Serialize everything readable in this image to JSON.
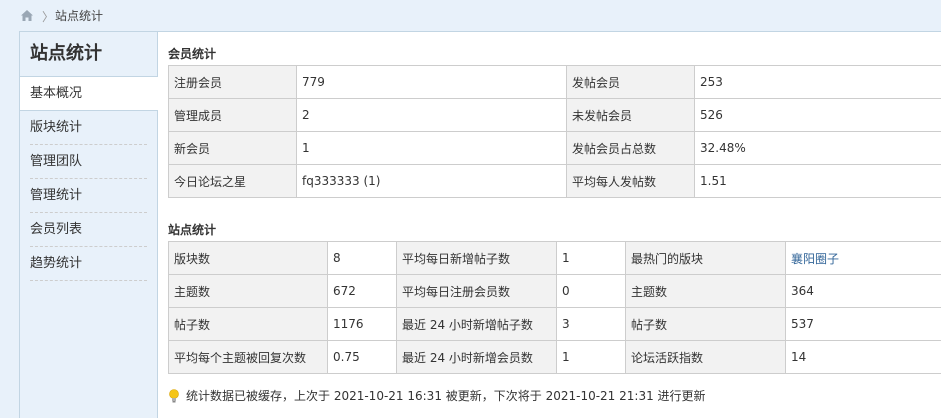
{
  "breadcrumb": {
    "separator": "〉",
    "current": "站点统计"
  },
  "sidebar": {
    "title": "站点统计",
    "items": [
      {
        "label": "基本概况"
      },
      {
        "label": "版块统计"
      },
      {
        "label": "管理团队"
      },
      {
        "label": "管理统计"
      },
      {
        "label": "会员列表"
      },
      {
        "label": "趋势统计"
      }
    ]
  },
  "member_stats": {
    "title": "会员统计",
    "rows": [
      [
        "注册会员",
        "779",
        "发帖会员",
        "253"
      ],
      [
        "管理成员",
        "2",
        "未发帖会员",
        "526"
      ],
      [
        "新会员",
        "1",
        "发帖会员占总数",
        "32.48%"
      ],
      [
        "今日论坛之星",
        "fq333333 (1)",
        "平均每人发帖数",
        "1.51"
      ]
    ]
  },
  "site_stats": {
    "title": "站点统计",
    "rows": [
      [
        "版块数",
        "8",
        "平均每日新增帖子数",
        "1",
        "最热门的版块",
        "襄阳圈子"
      ],
      [
        "主题数",
        "672",
        "平均每日注册会员数",
        "0",
        "主题数",
        "364"
      ],
      [
        "帖子数",
        "1176",
        "最近 24 小时新增帖子数",
        "3",
        "帖子数",
        "537"
      ],
      [
        "平均每个主题被回复次数",
        "0.75",
        "最近 24 小时新增会员数",
        "1",
        "论坛活跃指数",
        "14"
      ]
    ]
  },
  "notice": "统计数据已被缓存，上次于 2021-10-21 16:31 被更新，下次将于 2021-10-21 21:31 进行更新",
  "colors": {
    "link": "#336699",
    "border": "#c2d5e3",
    "key_bg": "#f2f2f2"
  }
}
